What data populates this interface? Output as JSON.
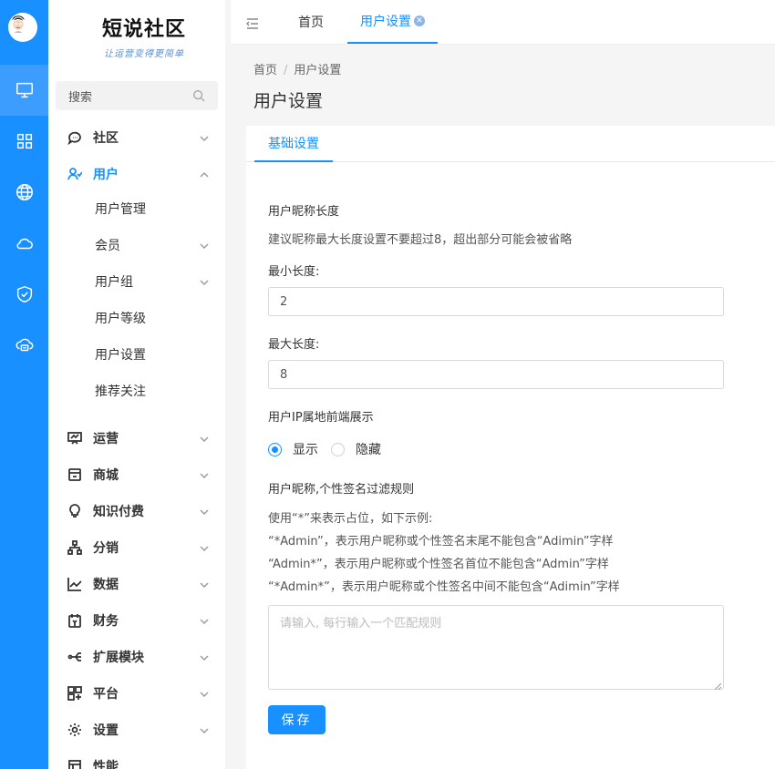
{
  "app": {
    "logo_title": "短说社区",
    "logo_slogan": "让运营变得更简单"
  },
  "search": {
    "placeholder": "搜索"
  },
  "sidebar": {
    "items": [
      {
        "label": "社区",
        "icon": "chat-icon"
      },
      {
        "label": "用户",
        "icon": "user-icon",
        "open": true
      },
      {
        "label": "运营",
        "icon": "presentation-icon"
      },
      {
        "label": "商城",
        "icon": "store-icon"
      },
      {
        "label": "知识付费",
        "icon": "lightbulb-icon"
      },
      {
        "label": "分销",
        "icon": "network-icon"
      },
      {
        "label": "数据",
        "icon": "chart-icon"
      },
      {
        "label": "财务",
        "icon": "finance-icon"
      },
      {
        "label": "扩展模块",
        "icon": "extension-icon"
      },
      {
        "label": "平台",
        "icon": "platform-icon"
      },
      {
        "label": "设置",
        "icon": "gear-icon"
      },
      {
        "label": "性能",
        "icon": "performance-icon"
      }
    ],
    "user_sub": [
      {
        "label": "用户管理",
        "chevron": false
      },
      {
        "label": "会员",
        "chevron": true
      },
      {
        "label": "用户组",
        "chevron": true
      },
      {
        "label": "用户等级",
        "chevron": false
      },
      {
        "label": "用户设置",
        "chevron": false
      },
      {
        "label": "推荐关注",
        "chevron": false
      }
    ]
  },
  "topbar": {
    "tabs": [
      {
        "label": "首页"
      },
      {
        "label": "用户设置",
        "active": true
      }
    ]
  },
  "breadcrumb": {
    "home": "首页",
    "sep": "/",
    "current": "用户设置"
  },
  "page": {
    "title": "用户设置"
  },
  "form": {
    "tab": "基础设置",
    "nick_title": "用户昵称长度",
    "nick_hint": "建议昵称最大长度设置不要超过8，超出部分可能会被省略",
    "min_label": "最小长度:",
    "min_value": "2",
    "max_label": "最大长度:",
    "max_value": "8",
    "ip_title": "用户IP属地前端展示",
    "ip_options": [
      "显示",
      "隐藏"
    ],
    "ip_selected": "显示",
    "filter_title": "用户昵称,个性签名过滤规则",
    "filter_lines": [
      "使用“*”来表示占位，如下示例:",
      "“*Admin”，表示用户昵称或个性签名末尾不能包含“Adimin”字样",
      "“Admin*”，表示用户昵称或个性签名首位不能包含“Admin”字样",
      "“*Admin*”，表示用户昵称或个性签名中间不能包含“Adimin”字样"
    ],
    "filter_placeholder": "请输入, 每行输入一个匹配规则",
    "save_label": "保存"
  },
  "colors": {
    "primary": "#1890ff",
    "rail_active": "#3c9dff"
  }
}
